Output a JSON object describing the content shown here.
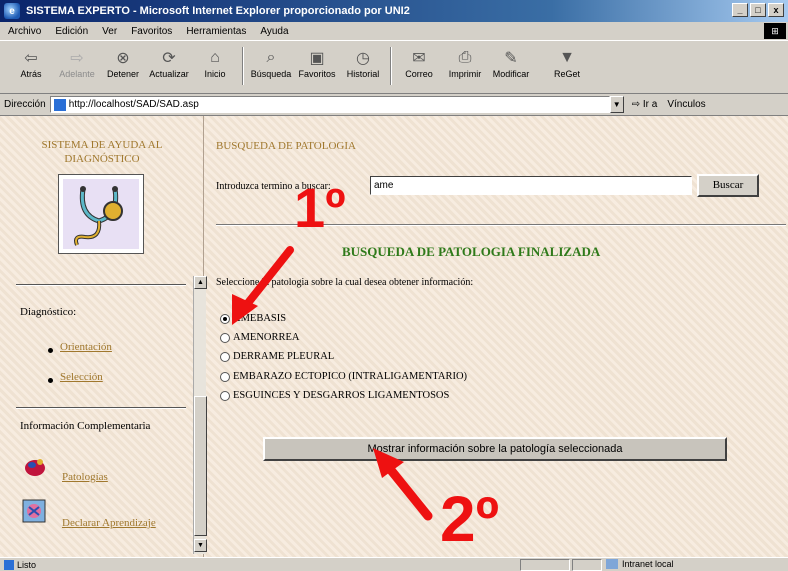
{
  "window": {
    "title": "SISTEMA EXPERTO - Microsoft Internet Explorer proporcionado por UNI2",
    "buttons": [
      "_",
      "□",
      "x"
    ]
  },
  "menu": [
    "Archivo",
    "Edición",
    "Ver",
    "Favoritos",
    "Herramientas",
    "Ayuda"
  ],
  "toolbar": {
    "back": "Atrás",
    "forward": "Adelante",
    "stop": "Detener",
    "refresh": "Actualizar",
    "home": "Inicio",
    "search": "Búsqueda",
    "favorites": "Favoritos",
    "history": "Historial",
    "mail": "Correo",
    "print": "Imprimir",
    "edit": "Modificar",
    "filter": "ReGet"
  },
  "address": {
    "label": "Dirección",
    "url": "http://localhost/SAD/SAD.asp",
    "go": "Ir a",
    "links": "Vínculos"
  },
  "sidebar": {
    "title_line1": "SISTEMA DE AYUDA AL",
    "title_line2": "DIAGNÓSTICO",
    "diagnostico": "Diagnóstico:",
    "orientacion": "Orientación",
    "seleccion": "Selección",
    "info": "Información Complementaria",
    "patologias": "Patologías",
    "aprendizaje": "Declarar Aprendizaje"
  },
  "main": {
    "heading": "BUSQUEDA DE PATOLOGIA",
    "intro_label": "Introduzca termino a buscar:",
    "search_value": "ame",
    "search_button": "Buscar",
    "done_heading": "BUSQUEDA DE PATOLOGIA FINALIZADA",
    "select_label": "Seleccione la patologia sobre la cual desea obtener información:",
    "options": [
      "AMEBASIS",
      "AMENORREA",
      "DERRAME PLEURAL",
      "EMBARAZO ECTOPICO (INTRALIGAMENTARIO)",
      "ESGUINCES Y DESGARROS LIGAMENTOSOS"
    ],
    "selected_index": 0,
    "show_button": "Mostrar información sobre la patología seleccionada"
  },
  "annotations": {
    "step1": "1º",
    "step2": "2º"
  },
  "status": {
    "text": "Listo",
    "zone": "Intranet local"
  },
  "colors": {
    "link": "#a0782d",
    "done_heading": "#2f7a1a",
    "annotation": "#ee1111",
    "background": "#f4e6d6"
  }
}
